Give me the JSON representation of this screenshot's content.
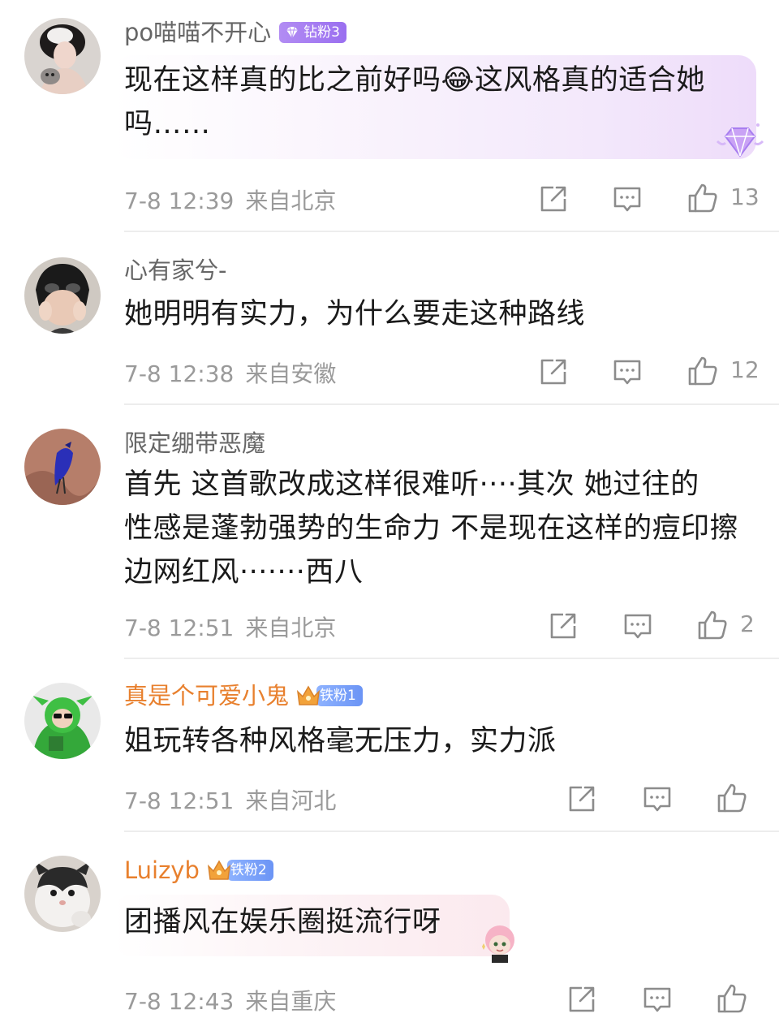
{
  "comments": [
    {
      "username": "po喵喵不开心",
      "badge": "钻粉3",
      "badge_type": "diamond",
      "text_lines": [
        "现在这样真的比之前好吗😂这风格真的适合她",
        "吗……"
      ],
      "time": "7-8 12:39",
      "location": "来自北京",
      "likes": "13"
    },
    {
      "username": "心有家兮-",
      "badge": "",
      "text_lines": [
        "她明明有实力，为什么要走这种路线"
      ],
      "time": "7-8 12:38",
      "location": "来自安徽",
      "likes": "12"
    },
    {
      "username": "限定绷带恶魔",
      "badge": "",
      "text_lines": [
        "首先 这首歌改成这样很难听····其次 她过往的",
        "性感是蓬勃强势的生命力 不是现在这样的痘印擦",
        "边网红风·······西八"
      ],
      "time": "7-8 12:51",
      "location": "来自北京",
      "likes": "2"
    },
    {
      "username": "真是个可爱小鬼",
      "badge": "铁粉1",
      "badge_type": "iron",
      "text_lines": [
        "姐玩转各种风格毫无压力，实力派"
      ],
      "time": "7-8 12:51",
      "location": "来自河北",
      "likes": ""
    },
    {
      "username": "Luizyb",
      "badge": "铁粉2",
      "badge_type": "iron",
      "text_lines": [
        "团播风在娱乐圈挺流行呀"
      ],
      "time": "7-8 12:43",
      "location": "来自重庆",
      "likes": ""
    }
  ],
  "colors": {
    "vip_name": "#e8802e",
    "normal_name": "#666666",
    "meta": "#9a9a9a",
    "divider": "#ededed"
  },
  "icons": [
    "share-icon",
    "reply-icon",
    "like-icon",
    "diamond-icon",
    "crown-icon"
  ]
}
